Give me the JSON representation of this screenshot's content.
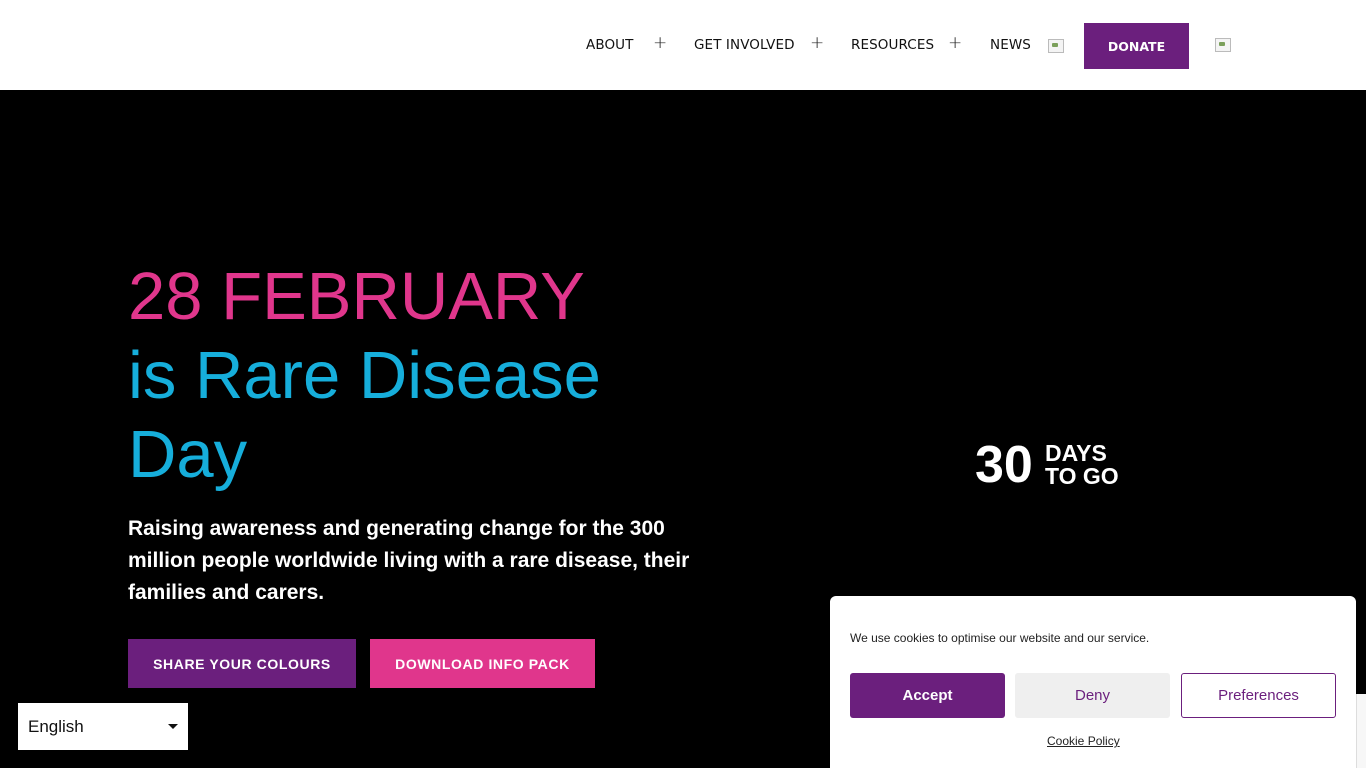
{
  "nav": {
    "items": [
      {
        "label": "ABOUT"
      },
      {
        "label": "GET INVOLVED"
      },
      {
        "label": "RESOURCES"
      },
      {
        "label": "NEWS"
      }
    ],
    "plus": "+",
    "donate_label": "DONATE"
  },
  "hero": {
    "date_line": "28 FEBRUARY",
    "line2": "is Rare Disease",
    "line3": "Day",
    "lead": "Raising awareness and generating change for the 300 million people worldwide living with a rare disease, their families and carers.",
    "share_label": "SHARE YOUR COLOURS",
    "download_label": "DOWNLOAD INFO PACK"
  },
  "countdown": {
    "number": "30",
    "days": "DAYS",
    "to_go": "TO GO"
  },
  "language": {
    "selected": "English"
  },
  "cookie": {
    "message": "We use cookies to optimise our website and our service.",
    "accept_label": "Accept",
    "deny_label": "Deny",
    "preferences_label": "Preferences",
    "policy_label": "Cookie Policy"
  },
  "colors": {
    "purple": "#6b1f7d",
    "pink": "#e0368c",
    "blue": "#16aedb"
  }
}
